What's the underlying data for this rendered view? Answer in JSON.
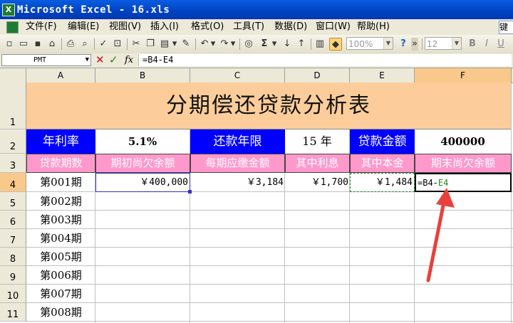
{
  "window": {
    "title": "Microsoft Excel - 16.xls",
    "app_icon": "X"
  },
  "menu": [
    {
      "label": "文件(F)",
      "id": "file"
    },
    {
      "label": "编辑(E)",
      "id": "edit"
    },
    {
      "label": "视图(V)",
      "id": "view"
    },
    {
      "label": "插入(I)",
      "id": "insert"
    },
    {
      "label": "格式(O)",
      "id": "format"
    },
    {
      "label": "工具(T)",
      "id": "tools"
    },
    {
      "label": "数据(D)",
      "id": "data"
    },
    {
      "label": "窗口(W)",
      "id": "window"
    },
    {
      "label": "帮助(H)",
      "id": "help"
    }
  ],
  "help_box": {
    "text": "键"
  },
  "toolbar": {
    "zoom": "100%",
    "font_size": "12",
    "sigma": "Σ"
  },
  "formula_bar": {
    "name_box": "PMT",
    "formula": "=B4-E4",
    "fx": "fx"
  },
  "columns": [
    "A",
    "B",
    "C",
    "D",
    "E",
    "F"
  ],
  "rows": [
    "1",
    "2",
    "3",
    "4",
    "5",
    "6",
    "7",
    "8",
    "9",
    "10",
    "11"
  ],
  "sheet": {
    "title": "分期偿还贷款分析表",
    "row2": {
      "rate_label": "年利率",
      "rate_value": "5.1%",
      "years_label": "还款年限",
      "years_value": "15 年",
      "amount_label": "贷款金额",
      "amount_value": "400000"
    },
    "headers": [
      "贷款期数",
      "期初尚欠余额",
      "每期应缴金额",
      "其中利息",
      "其中本金",
      "期末尚欠余额"
    ],
    "row4": {
      "period": "第001期",
      "opening_balance": "￥400,000",
      "payment": "￥3,184",
      "interest": "￥1,700",
      "principal": "￥1,484",
      "formula_prefix": "=B4-",
      "formula_ref": "E4"
    },
    "periods": [
      "第002期",
      "第003期",
      "第004期",
      "第005期",
      "第006期",
      "第007期",
      "第008期"
    ]
  },
  "colors": {
    "title_bar": "#0042c4",
    "title_fill": "#fccd9a",
    "label_blue": "#0000ff",
    "header_pink": "#ff99cc",
    "annotation_arrow": "#e8413c"
  }
}
